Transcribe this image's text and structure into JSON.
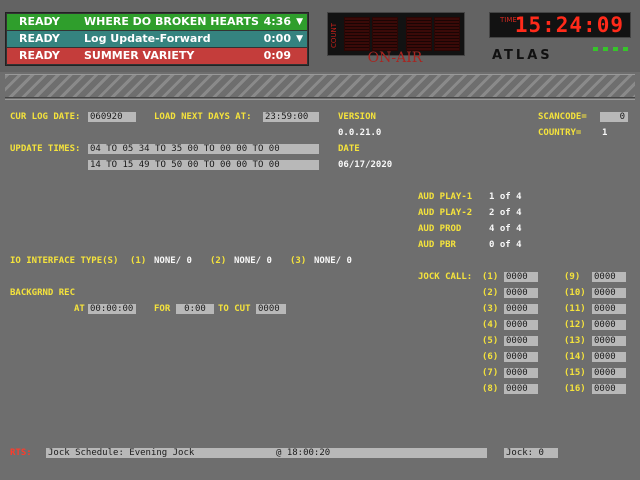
{
  "queue": [
    {
      "status": "READY",
      "title": "WHERE DO BROKEN HEARTS",
      "time": "4:36",
      "arrow": "▼",
      "color": "#2f9e2c"
    },
    {
      "status": "READY",
      "title": "Log Update-Forward",
      "time": "0:00",
      "arrow": "▼",
      "color": "#35837f"
    },
    {
      "status": "READY",
      "title": "SUMMER VARIETY",
      "time": "0:09",
      "arrow": "",
      "color": "#c43d3b"
    }
  ],
  "count": {
    "label": "COUNT",
    "on_air": "ON-AIR"
  },
  "clock": {
    "label": "TIME",
    "value": "15:24:09"
  },
  "brand": "ATLAS",
  "log": {
    "cur_log_date_label": "CUR LOG DATE:",
    "cur_log_date": "060920",
    "load_next_label": "LOAD NEXT DAYS AT:",
    "load_next": "23:59:00",
    "version_label": "VERSION",
    "version": "0.0.21.0",
    "date_label": "DATE",
    "date": "06/17/2020",
    "scancode_label": "SCANCODE=",
    "scancode": "0",
    "country_label": "COUNTRY=",
    "country": "1"
  },
  "update_times": {
    "label": "UPDATE TIMES:",
    "row1": "04 TO 05  34 TO 35  00 TO 00  00 TO 00",
    "row2": "14 TO 15  49 TO 50  00 TO 00  00 TO 00"
  },
  "audio": [
    {
      "label": "AUD PLAY-1",
      "value": "1 of 4"
    },
    {
      "label": "AUD PLAY-2",
      "value": "2 of 4"
    },
    {
      "label": "AUD PROD",
      "value": "4 of 4"
    },
    {
      "label": "AUD PBR",
      "value": "0 of 4"
    }
  ],
  "io": {
    "label": "IO INTERFACE TYPE(S)",
    "items": [
      {
        "num": "(1)",
        "value": "NONE/ 0"
      },
      {
        "num": "(2)",
        "value": "NONE/ 0"
      },
      {
        "num": "(3)",
        "value": "NONE/ 0"
      }
    ]
  },
  "backgrnd": {
    "label": "BACKGRND REC",
    "at_label": "AT",
    "at": "00:00:00",
    "for_label": "FOR",
    "for": "0:00",
    "to_cut_label": "TO CUT",
    "to_cut": "0000"
  },
  "jock_call": {
    "label": "JOCK CALL:",
    "slots": [
      {
        "num": "(1)",
        "value": "0000"
      },
      {
        "num": "(2)",
        "value": "0000"
      },
      {
        "num": "(3)",
        "value": "0000"
      },
      {
        "num": "(4)",
        "value": "0000"
      },
      {
        "num": "(5)",
        "value": "0000"
      },
      {
        "num": "(6)",
        "value": "0000"
      },
      {
        "num": "(7)",
        "value": "0000"
      },
      {
        "num": "(8)",
        "value": "0000"
      },
      {
        "num": "(9)",
        "value": "0000"
      },
      {
        "num": "(10)",
        "value": "0000"
      },
      {
        "num": "(11)",
        "value": "0000"
      },
      {
        "num": "(12)",
        "value": "0000"
      },
      {
        "num": "(13)",
        "value": "0000"
      },
      {
        "num": "(14)",
        "value": "0000"
      },
      {
        "num": "(15)",
        "value": "0000"
      },
      {
        "num": "(16)",
        "value": "0000"
      }
    ]
  },
  "status_bar": {
    "rts_label": "RTS:",
    "schedule": "Jock Schedule: Evening Jock",
    "at_time": "@ 18:00:20",
    "jock": "Jock: 0"
  }
}
